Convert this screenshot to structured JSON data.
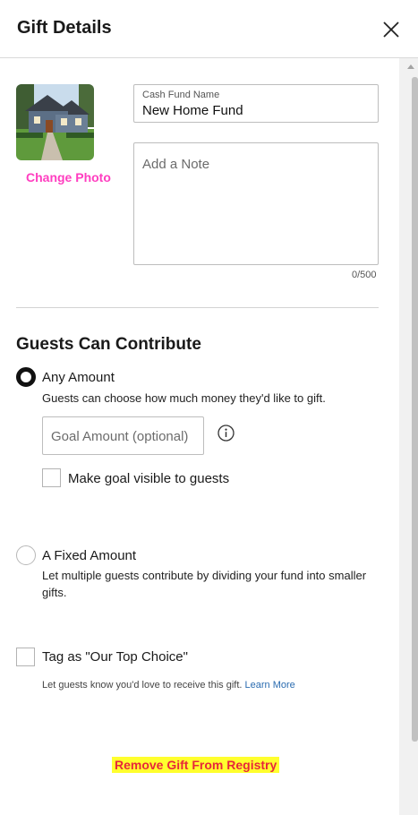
{
  "header": {
    "title": "Gift Details",
    "close_icon": "close-icon"
  },
  "photo": {
    "change_label": "Change Photo",
    "link_color": "#ff3ec0"
  },
  "fund_name": {
    "label": "Cash Fund Name",
    "value": "New Home Fund"
  },
  "note": {
    "placeholder": "Add a Note",
    "counter": "0/500"
  },
  "contribute": {
    "title": "Guests Can Contribute",
    "any_amount": {
      "label": "Any Amount",
      "description": "Guests can choose how much money they'd like to gift.",
      "selected": true
    },
    "goal": {
      "placeholder": "Goal Amount (optional)",
      "info_icon": "info-icon"
    },
    "goal_visible": {
      "label": "Make goal visible to guests",
      "checked": false
    },
    "fixed_amount": {
      "label": "A Fixed Amount",
      "description_line1": "Let multiple guests contribute by dividing your fund into smaller",
      "description_line2": "gifts.",
      "selected": false
    }
  },
  "top_choice": {
    "label": "Tag as \"Our Top Choice\"",
    "description": "Let guests know you'd love to receive this gift.",
    "learn_more": "Learn More",
    "checked": false
  },
  "remove": {
    "label": "Remove Gift From Registry",
    "color": "#e7273a",
    "highlight": "#ffff2e"
  }
}
